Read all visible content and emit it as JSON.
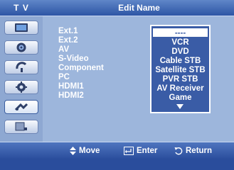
{
  "header": {
    "tv_label": "T V",
    "title": "Edit Name"
  },
  "sidebar": {
    "items": [
      {
        "icon": "picture-icon"
      },
      {
        "icon": "sound-icon"
      },
      {
        "icon": "channel-icon"
      },
      {
        "icon": "setup-icon"
      },
      {
        "icon": "input-icon"
      },
      {
        "icon": "digital-icon"
      }
    ]
  },
  "sources": [
    {
      "name": "Ext.1",
      "colon": ":"
    },
    {
      "name": "Ext.2",
      "colon": ":"
    },
    {
      "name": "AV",
      "colon": ":"
    },
    {
      "name": "S-Video",
      "colon": ":"
    },
    {
      "name": "Component",
      "colon": ":"
    },
    {
      "name": "PC",
      "colon": ":"
    },
    {
      "name": "HDMI1",
      "colon": ":"
    },
    {
      "name": "HDMI2",
      "colon": ":"
    }
  ],
  "dropdown": {
    "options": [
      "----",
      "VCR",
      "DVD",
      "Cable STB",
      "Satellite STB",
      "PVR STB",
      "AV Receiver",
      "Game"
    ],
    "selected_index": 0,
    "more_icon": "down-arrow-icon"
  },
  "footer": {
    "move": {
      "icon": "up-down-icon",
      "label": "Move"
    },
    "enter": {
      "icon": "enter-icon",
      "label": "Enter"
    },
    "return": {
      "icon": "return-icon",
      "label": "Return"
    }
  },
  "colors": {
    "panel": "#9db6dc",
    "header": "#2d55a5",
    "dropdown": "#3a5ca6"
  }
}
